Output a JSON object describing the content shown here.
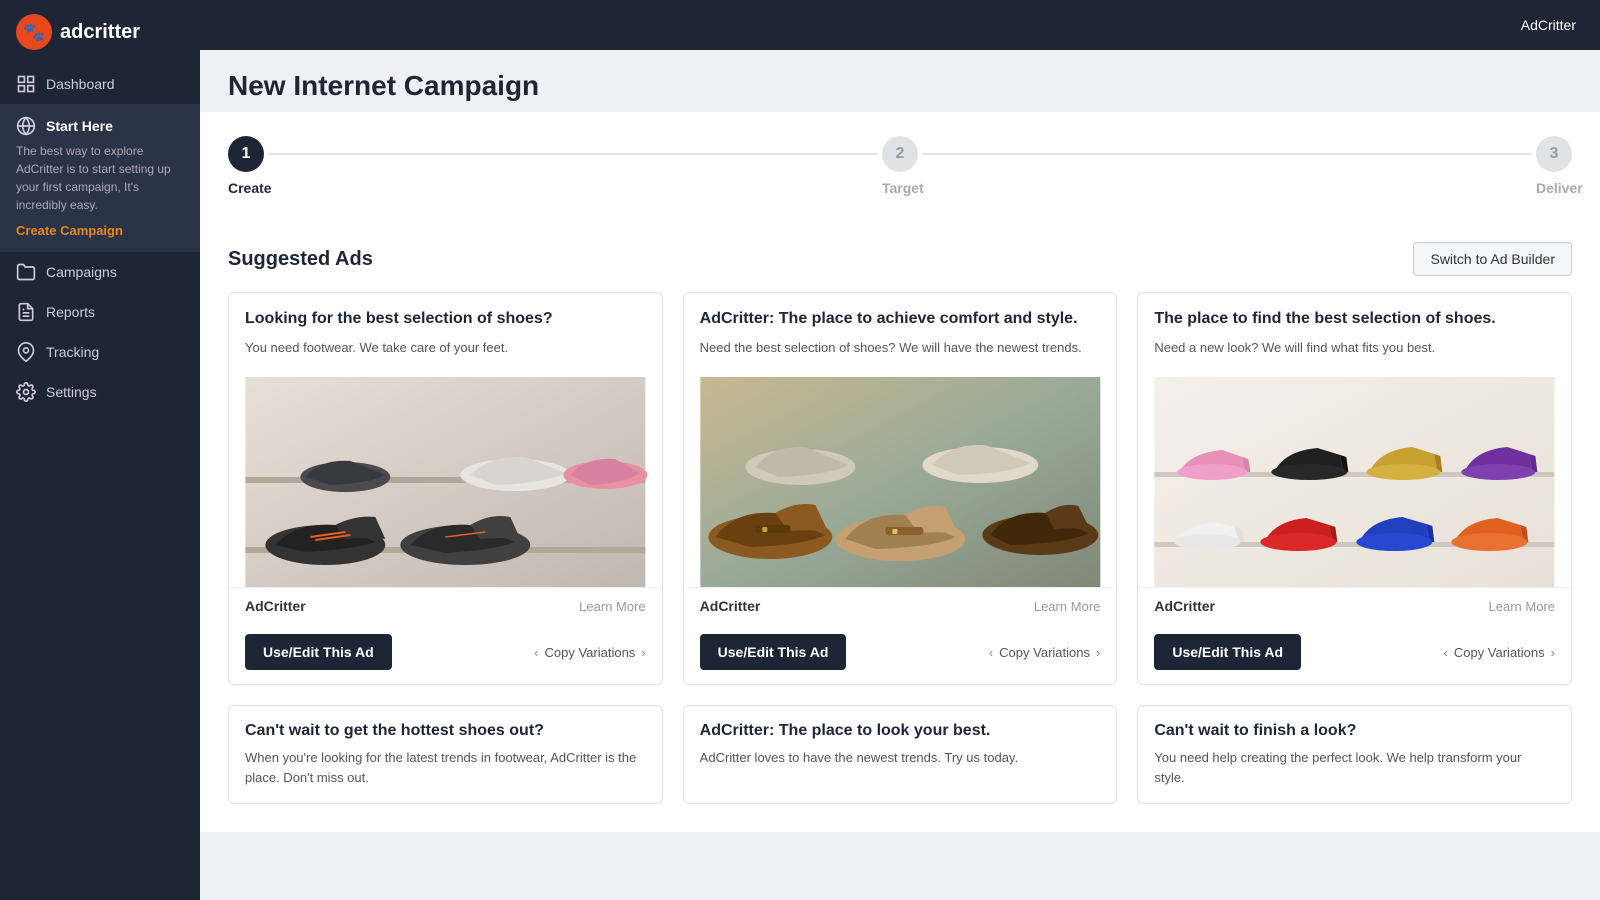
{
  "app": {
    "logo_text_bold": "ad",
    "logo_text_regular": "critter",
    "logo_emoji": "🐾",
    "top_user": "AdCritter"
  },
  "sidebar": {
    "items": [
      {
        "id": "dashboard",
        "label": "Dashboard",
        "icon": "grid"
      },
      {
        "id": "start-here",
        "label": "Start Here",
        "description": "The best way to explore AdCritter is to start setting up your first campaign, It's incredibly easy.",
        "cta": "Create Campaign"
      },
      {
        "id": "campaigns",
        "label": "Campaigns",
        "icon": "folder"
      },
      {
        "id": "reports",
        "label": "Reports",
        "icon": "file-text"
      },
      {
        "id": "tracking",
        "label": "Tracking",
        "icon": "map-pin"
      },
      {
        "id": "settings",
        "label": "Settings",
        "icon": "settings"
      }
    ]
  },
  "page": {
    "title": "New Internet Campaign"
  },
  "steps": [
    {
      "number": "1",
      "label": "Create",
      "active": true
    },
    {
      "number": "2",
      "label": "Target",
      "active": false
    },
    {
      "number": "3",
      "label": "Deliver",
      "active": false
    }
  ],
  "ads_section": {
    "title": "Suggested Ads",
    "switch_button": "Switch to Ad Builder"
  },
  "ads": [
    {
      "id": "ad1",
      "title": "Looking for the best selection of shoes?",
      "description": "You need footwear. We take care of your feet.",
      "brand": "AdCritter",
      "learn_more": "Learn More",
      "use_edit": "Use/Edit This Ad",
      "copy_variations": "Copy Variations"
    },
    {
      "id": "ad2",
      "title": "AdCritter: The place to achieve comfort and style.",
      "description": "Need the best selection of shoes? We will have the newest trends.",
      "brand": "AdCritter",
      "learn_more": "Learn More",
      "use_edit": "Use/Edit This Ad",
      "copy_variations": "Copy Variations"
    },
    {
      "id": "ad3",
      "title": "The place to find the best selection of shoes.",
      "description": "Need a new look? We will find what fits you best.",
      "brand": "AdCritter",
      "learn_more": "Learn More",
      "use_edit": "Use/Edit This Ad",
      "copy_variations": "Copy Variations"
    }
  ],
  "partial_ads": [
    {
      "id": "pad1",
      "title": "Can't wait to get the hottest shoes out?",
      "description": "When you're looking for the latest trends in footwear, AdCritter is the place. Don't miss out."
    },
    {
      "id": "pad2",
      "title": "AdCritter: The place to look your best.",
      "description": "AdCritter loves to have the newest trends. Try us today."
    },
    {
      "id": "pad3",
      "title": "Can't wait to finish a look?",
      "description": "You need help creating the perfect look. We help transform your style."
    }
  ]
}
